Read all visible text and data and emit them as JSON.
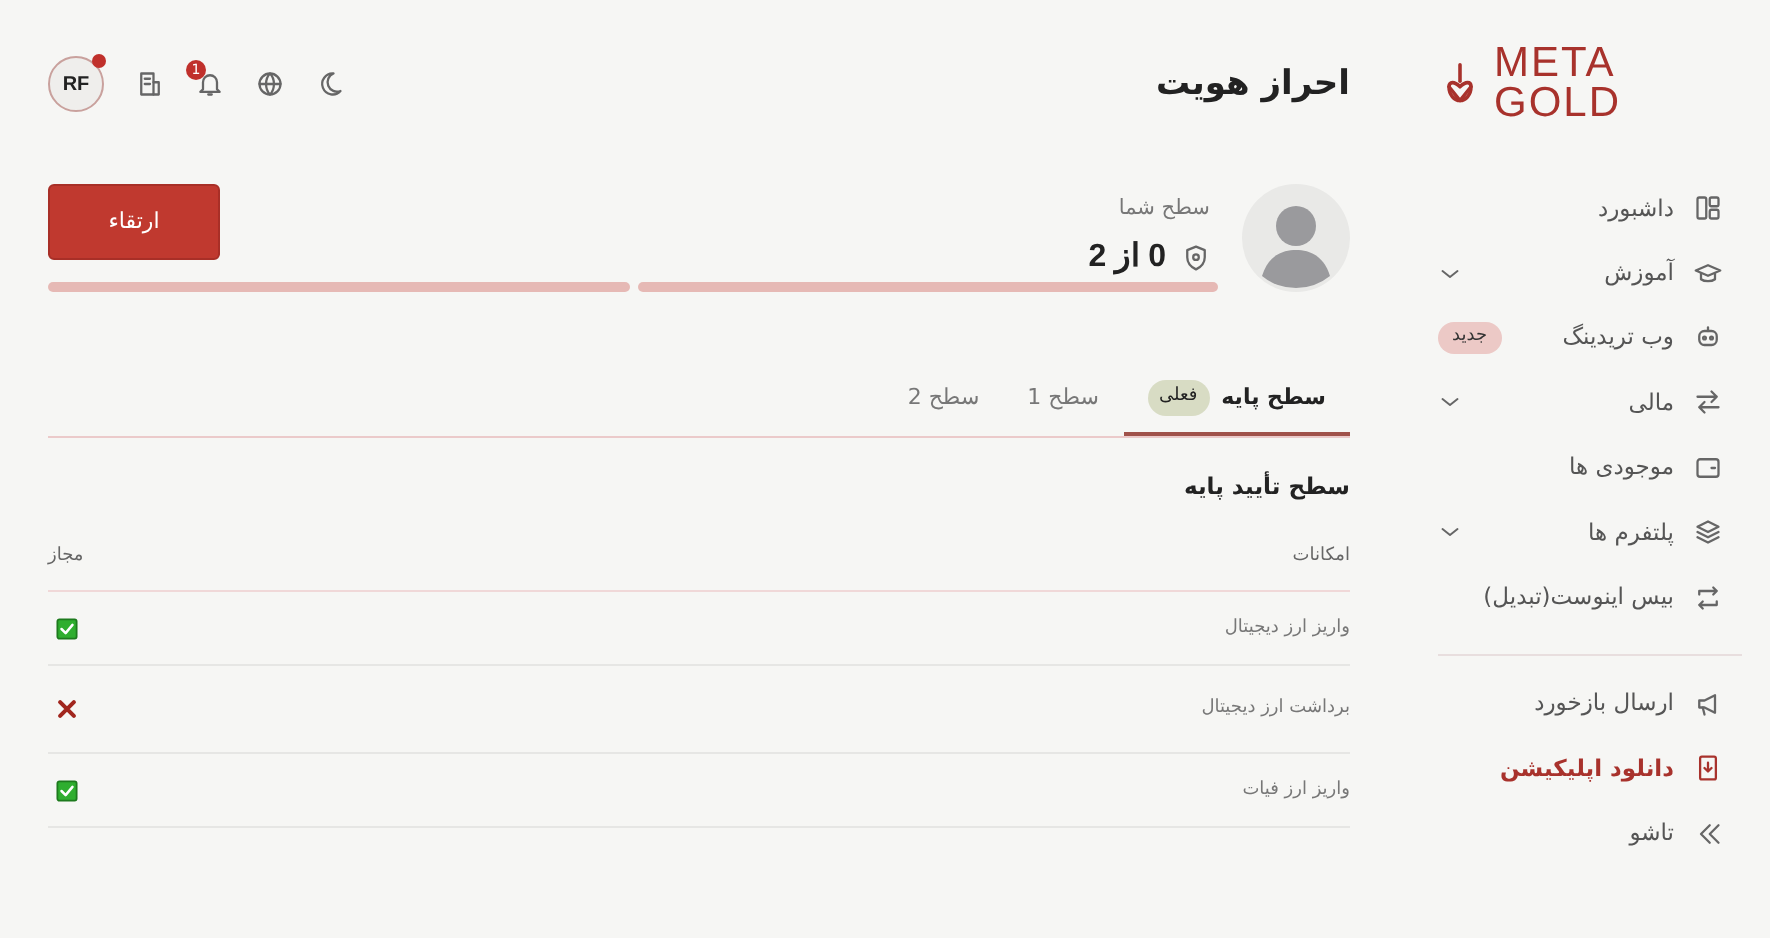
{
  "logo": {
    "line1": "META",
    "line2": "GOLD"
  },
  "sidebar": {
    "items": [
      {
        "label": "داشبورد",
        "kind": "plain",
        "selected": false
      },
      {
        "label": "آموزش",
        "kind": "expandable",
        "selected": false
      },
      {
        "label": "وب تریدینگ",
        "kind": "badge",
        "badge": "جدید",
        "selected": false
      },
      {
        "label": "مالی",
        "kind": "expandable",
        "selected": false
      },
      {
        "label": "موجودی ها",
        "kind": "plain",
        "selected": false
      },
      {
        "label": "پلتفرم ها",
        "kind": "expandable",
        "selected": false
      },
      {
        "label": "بیس اینوست(تبدیل)",
        "kind": "plain",
        "selected": false
      }
    ],
    "bottom_items": [
      {
        "label": "ارسال بازخورد",
        "selected": false
      },
      {
        "label": "دانلود اپلیکیشن",
        "selected": true
      },
      {
        "label": "تاشو",
        "selected": false
      }
    ]
  },
  "header": {
    "title": "احراز هویت",
    "notification_count": "1",
    "avatar": "RF",
    "avatar_dot": true
  },
  "level_card": {
    "label": "سطح شما",
    "value": "0 از 2",
    "button": "ارتقاء",
    "segments": [
      {
        "filled": false
      },
      {
        "filled": false
      }
    ]
  },
  "tabs": [
    {
      "label": "سطح پایه",
      "badge": "فعلی",
      "selected": true
    },
    {
      "label": "سطح 1",
      "selected": false
    },
    {
      "label": "سطح 2",
      "selected": false
    }
  ],
  "section_title": "سطح تأیید پایه",
  "table": {
    "columns": [
      "امکانات",
      "مجاز"
    ],
    "rows": [
      {
        "feature": "واریز ارز دیجیتال",
        "allowed": true
      },
      {
        "feature": "برداشت ارز دیجیتال",
        "allowed": false
      },
      {
        "feature": "واریز ارز فیات",
        "allowed": true
      }
    ]
  }
}
